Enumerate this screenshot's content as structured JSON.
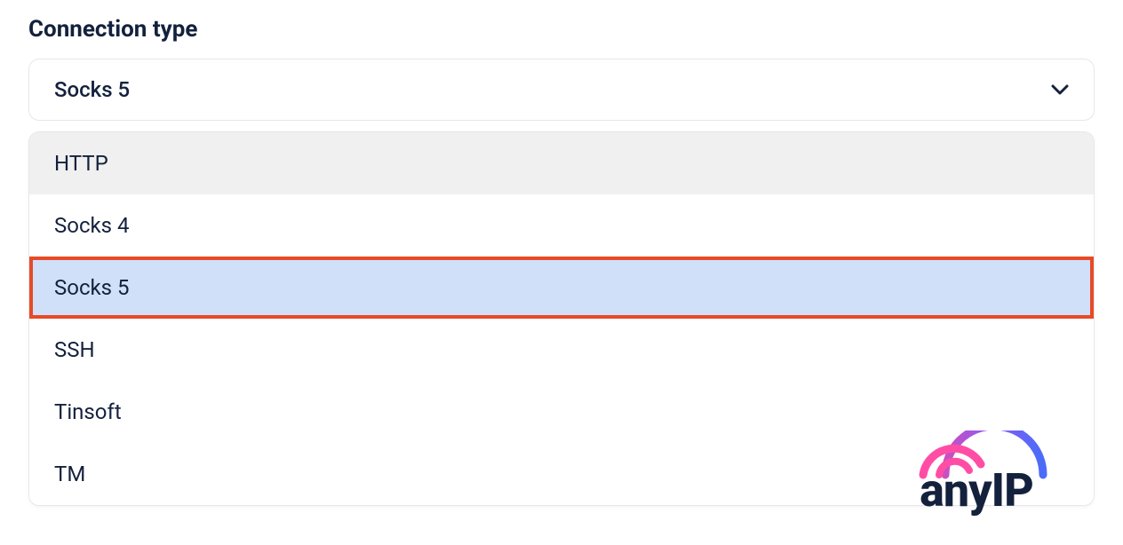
{
  "field": {
    "label": "Connection type",
    "selected_value": "Socks 5"
  },
  "options": [
    {
      "label": "HTTP",
      "state": "hovered"
    },
    {
      "label": "Socks 4",
      "state": "normal"
    },
    {
      "label": "Socks 5",
      "state": "selected"
    },
    {
      "label": "SSH",
      "state": "normal"
    },
    {
      "label": "Tinsoft",
      "state": "normal"
    },
    {
      "label": "TM",
      "state": "normal"
    }
  ],
  "logo": {
    "text": "anyIP"
  }
}
